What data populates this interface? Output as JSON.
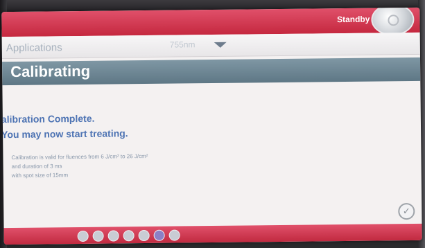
{
  "header": {
    "status": "Standby"
  },
  "appbar": {
    "applications_label": "Applications",
    "wavelength": "755nm"
  },
  "page": {
    "title": "Calibrating"
  },
  "message": {
    "line1": "alibration Complete.",
    "line2": "You may now start treating."
  },
  "details": {
    "line1": "Calibration is valid for fluences from 6 J/cm² to 26 J/cm²",
    "line2": "and duration of 3 ms",
    "line3": "with spot size of 15mm"
  },
  "confirm": {
    "symbol": "✓"
  },
  "pager": {
    "total": 7,
    "active_index": 5
  },
  "colors": {
    "accent": "#c5283f",
    "title_bar": "#6a8391",
    "message_text": "#4d73b3"
  }
}
